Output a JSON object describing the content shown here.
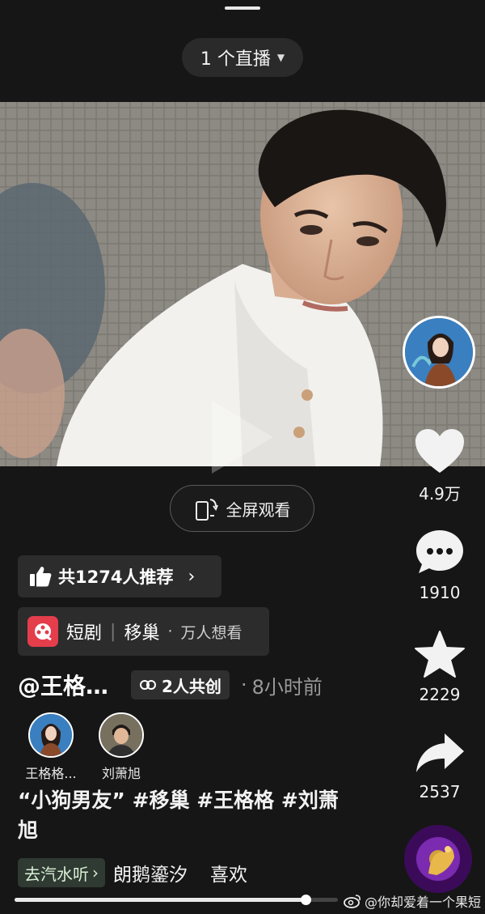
{
  "top": {
    "live_label": "1 个直播"
  },
  "video": {
    "fullscreen_label": "全屏观看"
  },
  "rail": {
    "likes": "4.9万",
    "comments": "1910",
    "favorites": "2229",
    "shares": "2537"
  },
  "recommend": {
    "label": "共1274人推荐"
  },
  "drama": {
    "tag": "短剧",
    "title": "移巢",
    "want": "万人想看"
  },
  "post": {
    "author": "@王格…",
    "cocreate": "2人共创",
    "time": "8小时前",
    "creators": [
      {
        "name": "王格格..."
      },
      {
        "name": "刘萧旭"
      }
    ],
    "caption": "“小狗男友” #移巢 #王格格 #刘萧旭"
  },
  "music": {
    "soda_label": "去汽水听",
    "song": "朗鹅鎏汐",
    "like": "喜欢"
  },
  "playback": {
    "progress": 0.9
  },
  "watermark": "@你却爱着一个果短",
  "colors": {
    "background": "#161616",
    "drama_logo": "#e43d4c",
    "soda_bg": "#2f3a32"
  }
}
